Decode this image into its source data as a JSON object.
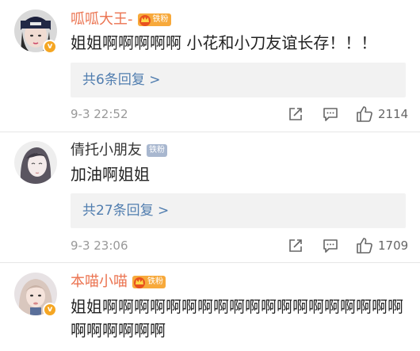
{
  "comments": [
    {
      "username": "呱呱大王-",
      "badge": "铁粉",
      "text": "姐姐啊啊啊啊啊 小花和小刀友谊长存！！！",
      "replies": "共6条回复 >",
      "time": "9-3 22:52",
      "likes": "2114"
    },
    {
      "username": "倩托小朋友",
      "badge": "铁粉",
      "text": "加油啊姐姐",
      "replies": "共27条回复 >",
      "time": "9-3 23:06",
      "likes": "1709"
    },
    {
      "username": "本喵小喵",
      "badge": "铁粉",
      "text": "姐姐啊啊啊啊啊啊啊啊啊啊啊啊啊啊啊啊啊啊啊啊啊啊啊啊啊"
    }
  ],
  "colors": {
    "vip_name": "#eb7350",
    "link": "#507daf",
    "meta": "#999999",
    "reply_bg": "#f2f2f2",
    "verified": "#f5a623"
  },
  "icons": [
    "share-icon",
    "comment-icon",
    "like-icon",
    "crown-icon",
    "verified-icon"
  ]
}
